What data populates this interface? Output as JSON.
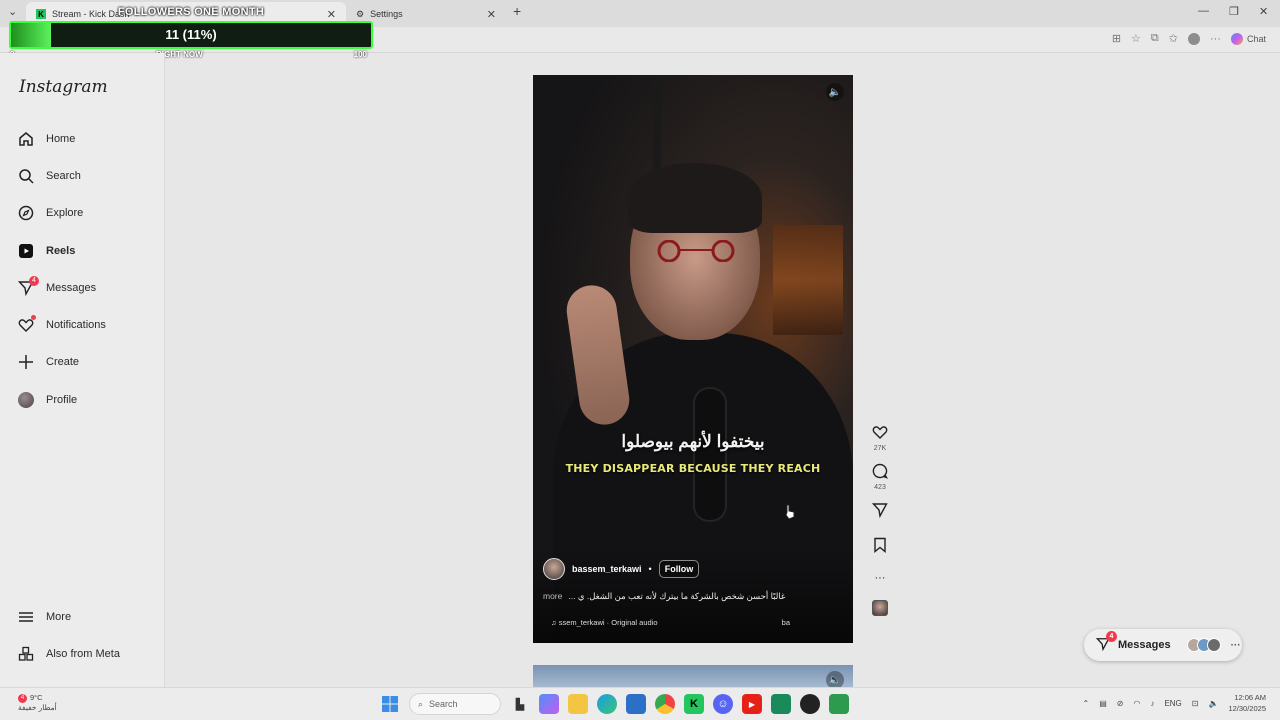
{
  "browser": {
    "tabs": [
      {
        "title": "Stream - Kick Dash",
        "favicon": "kick-icon"
      },
      {
        "title": "Settings",
        "favicon": "gear-icon"
      }
    ],
    "new_tab": "+",
    "chat_label": "Chat"
  },
  "followers_widget": {
    "title": "FOLLOWERS ONE MONTH",
    "value_text": "11 (11%)",
    "progress_fraction": 0.11,
    "min_label": "0",
    "center_label": "RIGHT NOW",
    "max_label": "100",
    "accent_color": "#3cff3c"
  },
  "sidebar": {
    "logo": "Instagram",
    "items": [
      {
        "label": "Home",
        "icon": "home-icon"
      },
      {
        "label": "Search",
        "icon": "search-icon"
      },
      {
        "label": "Explore",
        "icon": "compass-icon"
      },
      {
        "label": "Reels",
        "icon": "reels-icon",
        "active": true
      },
      {
        "label": "Messages",
        "icon": "messenger-icon",
        "badge": "4"
      },
      {
        "label": "Notifications",
        "icon": "heart-icon",
        "dot": true
      },
      {
        "label": "Create",
        "icon": "plus-icon"
      },
      {
        "label": "Profile",
        "icon": "avatar"
      }
    ],
    "bottom_items": [
      {
        "label": "More",
        "icon": "menu-icon"
      },
      {
        "label": "Also from Meta",
        "icon": "meta-apps-icon"
      }
    ]
  },
  "reel": {
    "subtitle_arabic": "بيختفوا لأنهم بيوصلوا",
    "subtitle_english": "THEY DISAPPEAR BECAUSE THEY REACH",
    "author": "bassem_terkawi",
    "separator": "•",
    "follow_label": "Follow",
    "caption": "غالبًا أحسن شخص بالشركة ما بيترك لأنه تعب من الشغل. ي ...",
    "caption_more": "more",
    "audio": "ssem_terkawi · Original audio",
    "audio_tag": "ba",
    "likes": "27K",
    "comments": "423"
  },
  "messages_pill": {
    "label": "Messages",
    "badge": "4",
    "more": "···"
  },
  "taskbar": {
    "weather_temp": "9°C",
    "weather_text": "أمطار خفيفة",
    "weather_badge": "4",
    "search_placeholder": "Search",
    "language": "ENG",
    "time": "12:06 AM",
    "date": "12/30/2025"
  }
}
